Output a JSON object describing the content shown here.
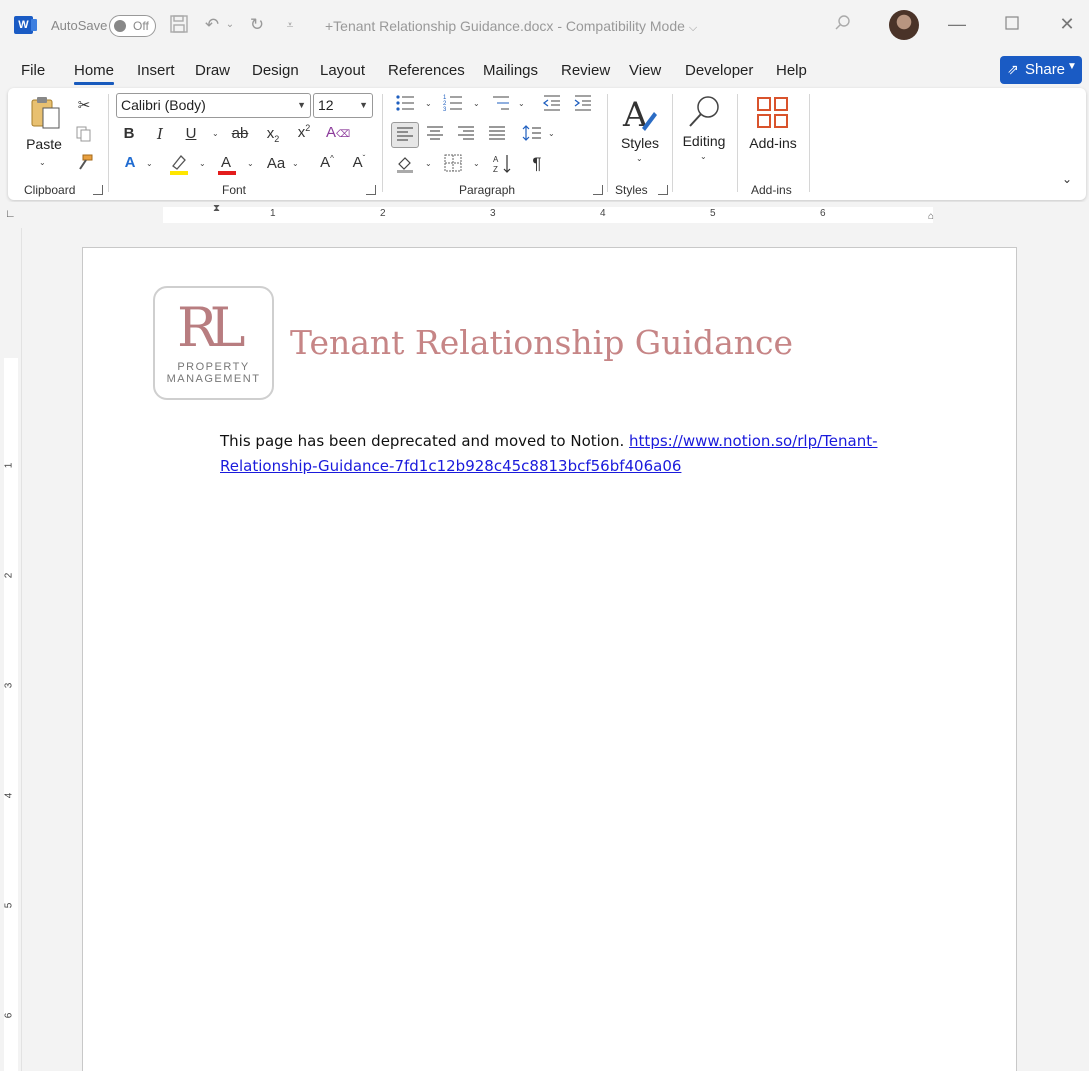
{
  "titlebar": {
    "app_logo": "W",
    "autosave_label": "AutoSave",
    "autosave_state": "Off",
    "document_title": "+Tenant Relationship Guidance.docx  -  Compatibility Mode",
    "title_chevron": "⌵"
  },
  "menu": {
    "tabs": [
      "File",
      "Home",
      "Insert",
      "Draw",
      "Design",
      "Layout",
      "References",
      "Mailings",
      "Review",
      "View",
      "Developer",
      "Help"
    ],
    "active_tab": "Home",
    "share_label": "Share"
  },
  "ribbon": {
    "clipboard": {
      "paste_label": "Paste",
      "group_label": "Clipboard"
    },
    "font": {
      "font_name": "Calibri (Body)",
      "font_size": "12",
      "group_label": "Font"
    },
    "paragraph": {
      "group_label": "Paragraph"
    },
    "styles": {
      "styles_label": "Styles",
      "group_label": "Styles"
    },
    "editing": {
      "editing_label": "Editing"
    },
    "addins": {
      "addins_label": "Add-ins",
      "group_label": "Add-ins"
    }
  },
  "ruler": {
    "h_numbers": [
      "1",
      "2",
      "3",
      "4",
      "5",
      "6"
    ],
    "v_numbers": [
      "1",
      "2",
      "3",
      "4",
      "5",
      "6"
    ]
  },
  "document": {
    "logo_initials": "RL",
    "logo_line1": "PROPERTY",
    "logo_line2": "MANAGEMENT",
    "heading": "Tenant Relationship Guidance",
    "body_text": "This page has been deprecated and moved to Notion.",
    "link_text": "https://www.notion.so/rlp/Tenant-Relationship-Guidance-7fd1c12b928c45c8813bcf56bf406a06"
  },
  "colors": {
    "accent": "#185abd",
    "heading": "#c68586",
    "logo": "#b87d80",
    "link": "#1a1adc"
  }
}
